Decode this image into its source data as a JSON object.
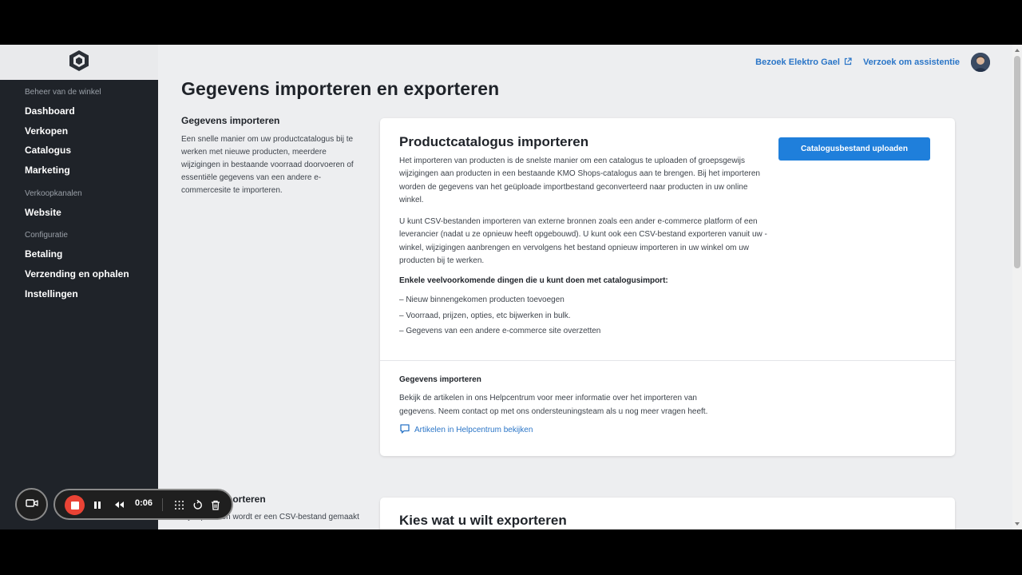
{
  "sidebar": {
    "sections": [
      {
        "title": "Beheer van de winkel",
        "items": [
          "Dashboard",
          "Verkopen",
          "Catalogus",
          "Marketing"
        ]
      },
      {
        "title": "Verkoopkanalen",
        "items": [
          "Website"
        ]
      },
      {
        "title": "Configuratie",
        "items": [
          "Betaling",
          "Verzending en ophalen",
          "Instellingen"
        ]
      }
    ]
  },
  "topbar": {
    "visit_link": "Bezoek Elektro Gael",
    "assist_link": "Verzoek om assistentie"
  },
  "page": {
    "title": "Gegevens importeren en exporteren"
  },
  "import_section": {
    "heading": "Gegevens importeren",
    "description": "Een snelle manier om uw productcatalogus bij te werken met nieuwe producten, meerdere wijzigingen in bestaande voorraad doorvoeren of essentiële gegevens van een andere e-commercesite te importeren."
  },
  "import_card": {
    "title": "Productcatalogus importeren",
    "upload_button": "Catalogusbestand uploaden",
    "paragraph1": "Het importeren van producten is de snelste manier om een catalogus te uploaden of groepsgewijs wijzigingen aan producten in een bestaande KMO Shops-catalogus aan te brengen. Bij het importeren worden de gegevens van het geüploade importbestand geconverteerd naar producten in uw online winkel.",
    "paragraph2": "U kunt CSV-bestanden importeren van externe bronnen zoals een ander e-commerce platform of een leverancier (nadat u ze opnieuw heeft opgebouwd). U kunt ook een CSV-bestand exporteren vanuit uw -winkel, wijzigingen aanbrengen en vervolgens het bestand opnieuw importeren in uw winkel om uw producten bij te werken.",
    "common_title": "Enkele veelvoorkomende dingen die u kunt doen met catalogusimport:",
    "bullets": [
      "–  Nieuw binnengekomen producten toevoegen",
      "–  Voorraad, prijzen, opties, etc bijwerken in bulk.",
      "–  Gegevens van een andere e-commerce site overzetten"
    ],
    "help_title": "Gegevens importeren",
    "help_text": "Bekijk de artikelen in ons Helpcentrum voor meer informatie over het importeren van gegevens. Neem contact op met ons ondersteuningsteam als u nog meer vragen heeft.",
    "help_link": "Artikelen in Helpcentrum bekijken"
  },
  "export_section": {
    "heading_partial": "porteren",
    "description_partial": "Bij exporteren wordt er een CSV-bestand gemaakt"
  },
  "export_card": {
    "title": "Kies wat u wilt exporteren"
  },
  "recorder": {
    "time": "0:06"
  },
  "colors": {
    "sidebar_bg": "#1f2329",
    "accent": "#1f7fdb",
    "link": "#2a75c7",
    "page_bg": "#edeef0",
    "record_red": "#ea4335"
  }
}
